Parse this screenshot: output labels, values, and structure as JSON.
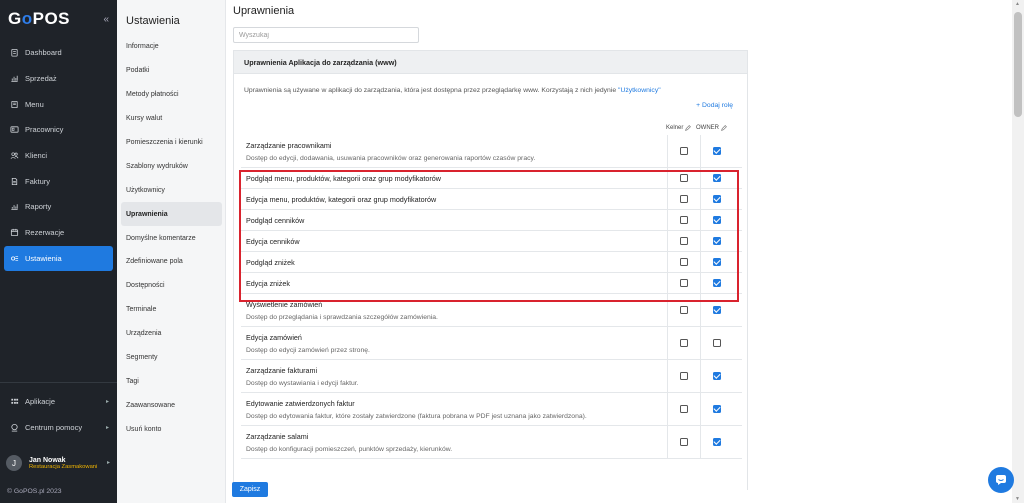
{
  "brand": {
    "logo_pre": "G",
    "logo_o": "o",
    "logo_post": "POS",
    "collapse": "«"
  },
  "sidebar": {
    "items": [
      {
        "label": "Dashboard",
        "icon": "clipboard-icon"
      },
      {
        "label": "Sprzedaż",
        "icon": "bar-chart-icon"
      },
      {
        "label": "Menu",
        "icon": "book-icon"
      },
      {
        "label": "Pracownicy",
        "icon": "id-card-icon"
      },
      {
        "label": "Klienci",
        "icon": "users-icon"
      },
      {
        "label": "Faktury",
        "icon": "document-icon"
      },
      {
        "label": "Raporty",
        "icon": "chart-icon"
      },
      {
        "label": "Rezerwacje",
        "icon": "calendar-icon"
      },
      {
        "label": "Ustawienia",
        "icon": "settings-icon",
        "active": true
      }
    ],
    "bottom": [
      {
        "label": "Aplikacje",
        "icon": "grid-icon"
      },
      {
        "label": "Centrum pomocy",
        "icon": "help-icon"
      }
    ],
    "user": {
      "initial": "J",
      "name": "Jan Nowak",
      "restaurant": "Restauracja Zasmakowani"
    },
    "copyright": "© GoPOS.pl 2023"
  },
  "submenu": {
    "title": "Ustawienia",
    "items": [
      "Informacje",
      "Podatki",
      "Metody płatności",
      "Kursy walut",
      "Pomieszczenia i kierunki",
      "Szablony wydruków",
      "Użytkownicy",
      "Uprawnienia",
      "Domyślne komentarze",
      "Zdefiniowane pola",
      "Dostępności",
      "Terminale",
      "Urządzenia",
      "Segmenty",
      "Tagi",
      "Zaawansowane",
      "Usuń konto"
    ],
    "active_index": 7
  },
  "main": {
    "title": "Uprawnienia",
    "search_placeholder": "Wyszukaj",
    "panel_title": "Uprawnienia Aplikacja do zarządzania (www)",
    "description": "Uprawnienia są używane w aplikacji do zarządzania, która jest dostępna przez przeglądarkę www. Korzystają z nich jedynie",
    "description_link": "\"Użytkownicy\"",
    "add_role": "+ Dodaj rolę",
    "col1": "Kelner",
    "col2": "OWNER",
    "save": "Zapisz",
    "permissions": [
      {
        "title": "Zarządzanie pracownikami",
        "desc": "Dostęp do edycji, dodawania, usuwania pracowników oraz generowania raportów czasów pracy.",
        "kelner": false,
        "owner": true
      },
      {
        "title": "Podgląd menu, produktów, kategorii oraz grup modyfikatorów",
        "desc": "",
        "kelner": false,
        "owner": true
      },
      {
        "title": "Edycja menu, produktów, kategorii oraz grup modyfikatorów",
        "desc": "",
        "kelner": false,
        "owner": true
      },
      {
        "title": "Podgląd cenników",
        "desc": "",
        "kelner": false,
        "owner": true
      },
      {
        "title": "Edycja cenników",
        "desc": "",
        "kelner": false,
        "owner": true
      },
      {
        "title": "Podgląd zniżek",
        "desc": "",
        "kelner": false,
        "owner": true
      },
      {
        "title": "Edycja zniżek",
        "desc": "",
        "kelner": false,
        "owner": true
      },
      {
        "title": "Wyświetlenie zamówień",
        "desc": "Dostęp do przeglądania i sprawdzania szczegółów zamówienia.",
        "kelner": false,
        "owner": true
      },
      {
        "title": "Edycja zamówień",
        "desc": "Dostęp do edycji zamówień przez stronę.",
        "kelner": false,
        "owner": false
      },
      {
        "title": "Zarządzanie fakturami",
        "desc": "Dostęp do wystawiania i edycji faktur.",
        "kelner": false,
        "owner": true
      },
      {
        "title": "Edytowanie zatwierdzonych faktur",
        "desc": "Dostęp do edytowania faktur, które zostały zatwierdzone (faktura pobrana w PDF jest uznana jako zatwierdzona).",
        "kelner": false,
        "owner": true
      },
      {
        "title": "Zarządzanie salami",
        "desc": "Dostęp do konfiguracji pomieszczeń, punktów sprzedaży, kierunków.",
        "kelner": false,
        "owner": true
      }
    ]
  },
  "colors": {
    "accent": "#1f7ae0",
    "sidebar_bg": "#1f2329",
    "highlight": "#d9232e"
  }
}
